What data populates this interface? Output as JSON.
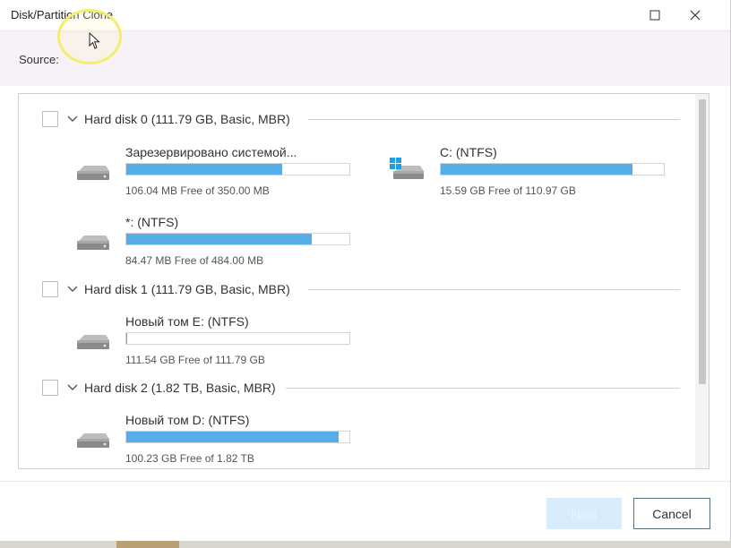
{
  "window": {
    "title": "Disk/Partition Clone",
    "maximize_icon": "maximize-icon",
    "close_icon": "close-icon"
  },
  "source": {
    "label": "Source:"
  },
  "disks": [
    {
      "title": "Hard disk 0 (111.79 GB, Basic, MBR)",
      "partitions": [
        {
          "name": "Зарезервировано системой...",
          "free": "106.04 MB Free of 350.00 MB",
          "used_fraction": 0.7,
          "icon": "drive-icon"
        },
        {
          "name": "C: (NTFS)",
          "free": "15.59 GB Free of 110.97 GB",
          "used_fraction": 0.86,
          "icon": "windows-drive-icon"
        },
        {
          "name": "*: (NTFS)",
          "free": "84.47 MB Free of 484.00 MB",
          "used_fraction": 0.83,
          "icon": "drive-icon"
        }
      ]
    },
    {
      "title": "Hard disk 1 (111.79 GB, Basic, MBR)",
      "partitions": [
        {
          "name": "Новый том E: (NTFS)",
          "free": "111.54 GB Free of 111.79 GB",
          "used_fraction": 0.005,
          "icon": "drive-icon"
        }
      ]
    },
    {
      "title": "Hard disk 2 (1.82 TB, Basic, MBR)",
      "partitions": [
        {
          "name": "Новый том D: (NTFS)",
          "free": "100.23 GB Free of 1.82 TB",
          "used_fraction": 0.95,
          "icon": "drive-icon"
        }
      ]
    }
  ],
  "buttons": {
    "next_label": "Next",
    "cancel_label": "Cancel"
  },
  "colors": {
    "bar_fill": "#56aee9",
    "windows_logo": "#1ba1e2",
    "highlight": "#f3ee6f"
  }
}
